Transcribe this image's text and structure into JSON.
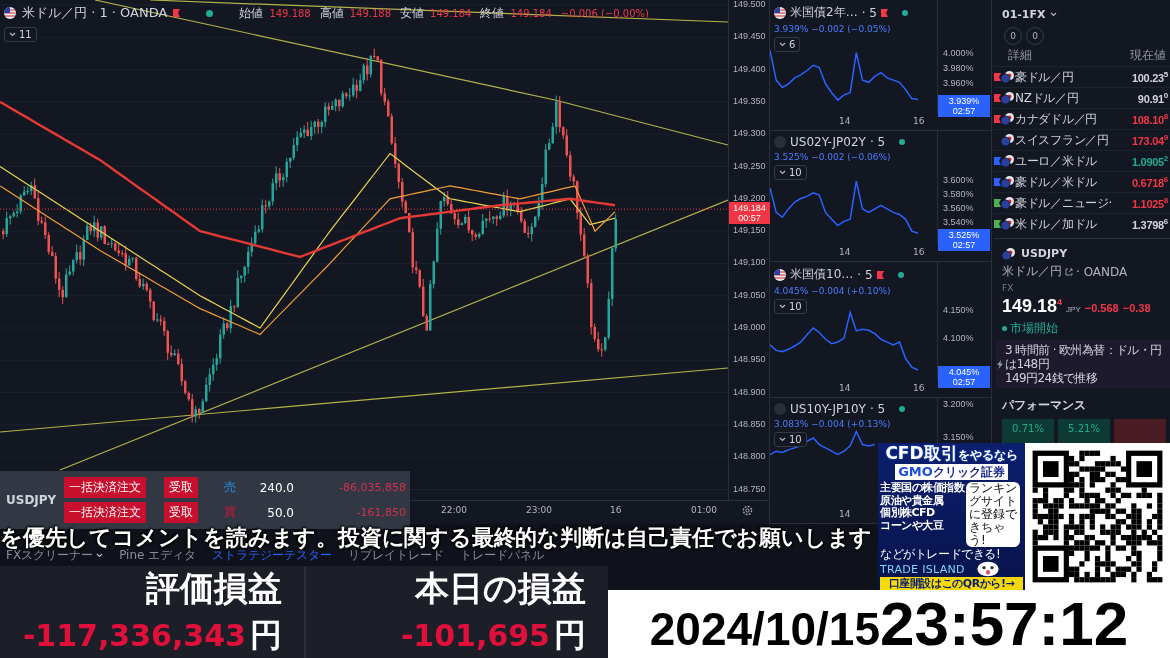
{
  "main_chart": {
    "symbol": "米ドル／円 · 1 · OANDA",
    "legend": [
      {
        "label": "始値",
        "value": "149.188"
      },
      {
        "label": "高値",
        "value": "149.188"
      },
      {
        "label": "安値",
        "value": "149.184"
      },
      {
        "label": "終値",
        "value": "149.184"
      }
    ],
    "change": "−0.006 (−0.00%)",
    "indicator_count": "11",
    "price_axis": [
      "149.500",
      "149.450",
      "149.400",
      "149.350",
      "149.300",
      "149.250",
      "149.200",
      "149.150",
      "149.100",
      "149.050",
      "149.000",
      "148.950",
      "148.900",
      "148.850",
      "148.800",
      "148.750"
    ],
    "current_price": "149.184",
    "countdown": "00:57",
    "time_axis": [
      "22:00",
      "23:00",
      "16",
      "01:00"
    ]
  },
  "mini_charts": [
    {
      "kind": "bond",
      "title": "米国債2年…",
      "interval": "· 5",
      "flagged": true,
      "value": "3.939% −0.002 (−0.05%)",
      "indicator_count": "6",
      "last": "3.939%",
      "countdown": "02:57",
      "time_axis": [
        "14",
        "16"
      ],
      "chart_data": {
        "type": "line",
        "ylim": [
          3.922,
          4.073
        ],
        "yticks": [
          {
            "value": 4.0,
            "label": "4.000%"
          },
          {
            "value": 3.98,
            "label": "3.980%"
          },
          {
            "value": 3.96,
            "label": "3.960%"
          }
        ],
        "series": [
          {
            "color": "#2962ff",
            "values": [
              4.005,
              3.965,
              3.955,
              3.96,
              3.968,
              3.972,
              3.978,
              3.985,
              3.982,
              3.96,
              3.948,
              3.938,
              3.945,
              3.948,
              4.002,
              3.965,
              3.962,
              3.97,
              3.975,
              3.968,
              3.965,
              3.962,
              3.952,
              3.94,
              3.939
            ]
          }
        ]
      }
    },
    {
      "kind": "spread",
      "title": "US02Y-JP02Y",
      "interval": "· 5",
      "flagged": false,
      "value": "3.525% −0.002 (−0.06%)",
      "indicator_count": "10",
      "last": "3.525%",
      "countdown": "02:57",
      "time_axis": [
        "14",
        "16"
      ],
      "chart_data": {
        "type": "line",
        "ylim": [
          3.511,
          3.672
        ],
        "yticks": [
          {
            "value": 3.6,
            "label": "3.600%"
          },
          {
            "value": 3.58,
            "label": "3.580%"
          },
          {
            "value": 3.56,
            "label": "3.560%"
          },
          {
            "value": 3.54,
            "label": "3.540%"
          }
        ],
        "series": [
          {
            "color": "#2962ff",
            "values": [
              3.59,
              3.555,
              3.548,
              3.56,
              3.57,
              3.575,
              3.578,
              3.583,
              3.58,
              3.555,
              3.545,
              3.536,
              3.542,
              3.545,
              3.6,
              3.56,
              3.555,
              3.56,
              3.565,
              3.56,
              3.555,
              3.552,
              3.545,
              3.528,
              3.525
            ]
          }
        ]
      }
    },
    {
      "kind": "bond",
      "title": "米国債10…",
      "interval": "· 5",
      "flagged": true,
      "value": "4.045% −0.004 (+0.10%)",
      "indicator_count": "10",
      "last": "4.045%",
      "countdown": "02:57",
      "time_axis": [
        "14",
        "16"
      ],
      "chart_data": {
        "type": "line",
        "ylim": [
          4.029,
          4.238
        ],
        "yticks": [
          {
            "value": 4.15,
            "label": "4.150%"
          },
          {
            "value": 4.1,
            "label": "4.100%"
          }
        ],
        "series": [
          {
            "color": "#2962ff",
            "values": [
              4.09,
              4.08,
              4.078,
              4.082,
              4.088,
              4.095,
              4.108,
              4.12,
              4.112,
              4.1,
              4.092,
              4.095,
              4.102,
              4.148,
              4.115,
              4.118,
              4.116,
              4.11,
              4.1,
              4.095,
              4.09,
              4.095,
              4.065,
              4.05,
              4.045
            ]
          }
        ]
      }
    },
    {
      "kind": "spread",
      "title": "US10Y-JP10Y",
      "interval": "· 5",
      "flagged": false,
      "value": "3.083% −0.004 (+0.13%)",
      "indicator_count": "10",
      "time_axis": [
        "14"
      ],
      "chart_data": {
        "type": "line",
        "ylim": [
          3.048,
          3.211
        ],
        "yticks": [
          {
            "value": 3.2,
            "label": "3.200%"
          },
          {
            "value": 3.15,
            "label": "3.150%"
          }
        ],
        "series": [
          {
            "color": "#2962ff",
            "values": [
              3.125,
              3.13,
              3.128,
              3.132,
              3.135,
              3.138,
              3.145,
              3.15,
              3.14,
              3.135,
              3.13,
              3.125,
              3.13,
              3.138,
              3.16,
              3.14,
              3.138,
              3.14,
              null,
              null,
              null,
              null,
              null,
              null,
              null
            ]
          }
        ]
      }
    }
  ],
  "watchlist": {
    "name": "01-1FX",
    "counters": [
      "0",
      "0"
    ],
    "columns": [
      "詳細",
      "現在値"
    ],
    "rows": [
      {
        "color": "#f23645",
        "name": "豪ドル／円",
        "price": "100.23",
        "pip": "5",
        "up": false,
        "down": false
      },
      {
        "color": "#f23645",
        "name": "NZドル／円",
        "price": "90.91",
        "pip": "0",
        "up": false,
        "down": false
      },
      {
        "color": "#f23645",
        "name": "カナダドル／円",
        "price": "108.10",
        "pip": "8",
        "up": false,
        "down": true
      },
      {
        "name": "スイスフラン／円",
        "price": "173.04",
        "pip": "9",
        "up": false,
        "down": true
      },
      {
        "color": "#2962ff",
        "name": "ユーロ／米ドル",
        "price": "1.0905",
        "pip": "2",
        "up": true,
        "down": false
      },
      {
        "color": "#2962ff",
        "name": "豪ドル／米ドル",
        "price": "0.6718",
        "pip": "6",
        "up": false,
        "down": true
      },
      {
        "color": "#4caf50",
        "name": "豪ドル／ニュージ·",
        "price": "1.1025",
        "pip": "8",
        "up": false,
        "down": true
      },
      {
        "color": "#4caf50",
        "name": "米ドル／加ドル",
        "price": "1.3798",
        "pip": "6",
        "up": false,
        "down": false
      }
    ]
  },
  "details": {
    "symbol": "USDJPY",
    "description": "米ドル／円",
    "exchange": "· OANDA",
    "type": "FX",
    "price": "149.18",
    "pip": "4",
    "currency": "JPY",
    "change": "−0.568",
    "change_percent": "−0.38",
    "market_status": "市場開始",
    "news": [
      "3 時間前 · 欧州為替：ドル・円は148円",
      "149円24銭で推移"
    ],
    "performance_title": "パフォーマンス",
    "performance": [
      {
        "value": "0.71%",
        "positive": true
      },
      {
        "value": "5.21%",
        "positive": true
      },
      {
        "positive": false
      }
    ]
  },
  "positions": {
    "symbol": "USDJPY",
    "rows": [
      {
        "close_label": "一括決済注文",
        "receive_label": "受取",
        "side": "売",
        "kind": "sell",
        "quantity": "240.0",
        "pnl": "-86,035,858"
      },
      {
        "close_label": "一括決済注文",
        "receive_label": "受取",
        "side": "買",
        "kind": "buy",
        "quantity": "50.0",
        "pnl": "-161,850"
      }
    ]
  },
  "subtitle": "を優先してコメントを読みます。投資に関する最終的な判断は自己責任でお願いします",
  "bottom_tabs": [
    {
      "label": "FXスクリーナー",
      "dropdown": true,
      "selected": false
    },
    {
      "label": "Pine エディタ",
      "dropdown": false,
      "selected": false
    },
    {
      "label": "ストラテジーテスター",
      "dropdown": false,
      "selected": true
    },
    {
      "label": "リプレイトレード",
      "dropdown": false,
      "selected": false
    },
    {
      "label": "トレードパネル",
      "dropdown": false,
      "selected": false
    }
  ],
  "pnl": [
    {
      "label": "評価損益",
      "value": "-117,336,343",
      "unit": "円"
    },
    {
      "label": "本日の損益",
      "value": "-101,695",
      "unit": "円"
    }
  ],
  "ad": {
    "headline": "CFD取引",
    "headline_tail": "をやるなら",
    "brand": "GMO",
    "brand_tail": "クリック証券",
    "bullets": [
      "主要国の株価指数",
      "原油や貴金属",
      "個別株CFD",
      "コーンや大豆"
    ],
    "note": "などがトレードできる!",
    "bubble": "ランキングサイトに登録できちゃう!",
    "logo": "TRADE ISLAND",
    "cta": "口座開設はこのQRから!→"
  },
  "clock": {
    "date": "2024/10/15",
    "time": "23:57:12"
  }
}
